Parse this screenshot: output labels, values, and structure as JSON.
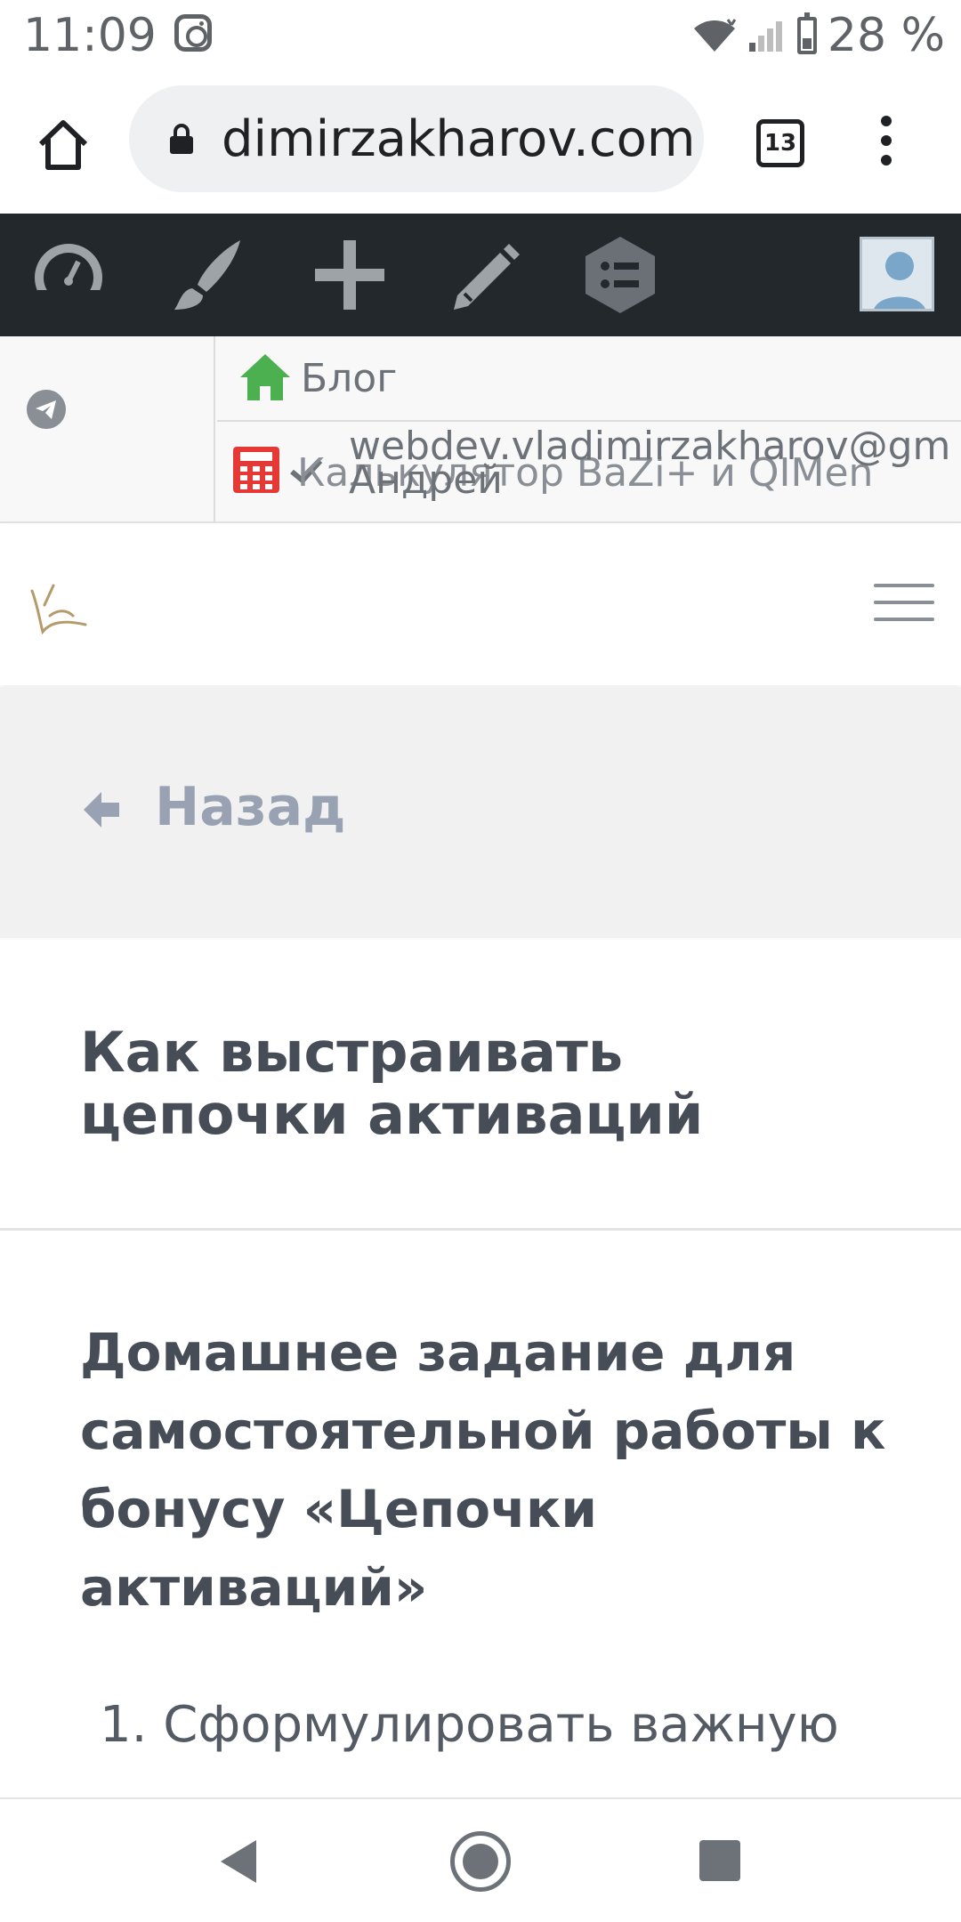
{
  "status_bar": {
    "time": "11:09",
    "battery_text": "28 %",
    "icons": [
      "instagram-icon",
      "wifi-icon",
      "signal-icon",
      "battery-icon"
    ]
  },
  "browser": {
    "url": "dimirzakharov.com",
    "tabs_count": "13",
    "icons": [
      "home-icon",
      "lock-icon",
      "tabs-icon",
      "menu-icon"
    ]
  },
  "admin_bar": {
    "items": [
      "dashboard-icon",
      "brush-icon",
      "plus-icon",
      "pencil-icon",
      "list-icon",
      "avatar"
    ],
    "background": "#23282d"
  },
  "sub_bar": {
    "blog_label": "Блог",
    "calculator_label": "Калькулятор BaZi+ и QIMen",
    "email": "webdev.vladimirzakharov@gm",
    "user_name": "Андрей",
    "home_icon_color": "#4caf50",
    "calculator_icon_color": "#e53935"
  },
  "site_header": {
    "logo": "logo-icon",
    "menu_icon": "hamburger-icon"
  },
  "back_section": {
    "back_label": "Назад"
  },
  "content": {
    "page_title": "Как выстраивать цепочки активаций",
    "homework_title": "Домашнее задание для самостоятельной работы к бонусу «Цепочки активаций»",
    "first_list_item": "1. Сформулировать важную"
  },
  "nav_bar": {
    "icons": [
      "back-icon",
      "home-icon",
      "recent-apps-icon"
    ]
  }
}
